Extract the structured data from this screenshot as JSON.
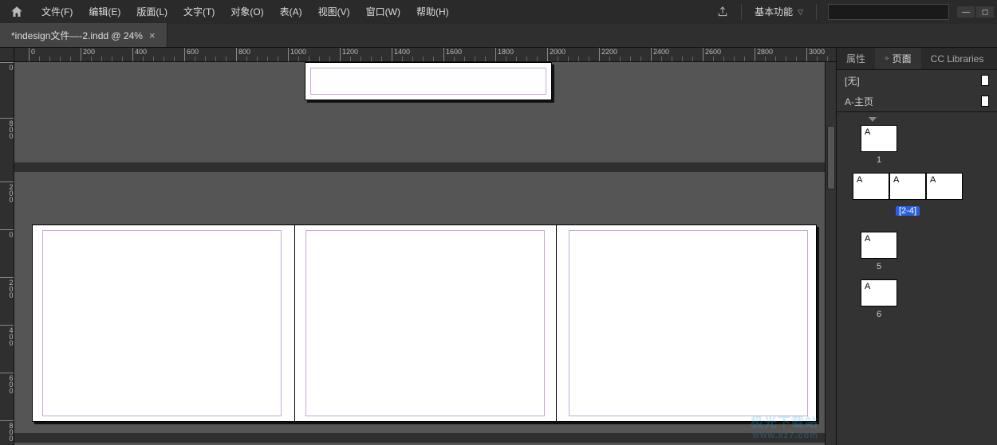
{
  "menubar": {
    "items": [
      "文件(F)",
      "编辑(E)",
      "版面(L)",
      "文字(T)",
      "对象(O)",
      "表(A)",
      "视图(V)",
      "窗口(W)",
      "帮助(H)"
    ],
    "workspace_label": "基本功能",
    "search_placeholder": ""
  },
  "document": {
    "tab_title": "*indesign文件—-2.indd @ 24%"
  },
  "rulers": {
    "h_ticks": [
      0,
      200,
      400,
      600,
      800,
      1000,
      1200,
      1400,
      1600,
      1800,
      2000,
      2200,
      2400,
      2600,
      2800,
      3000
    ],
    "v_ticks_upper": [
      0,
      800
    ],
    "v_ticks_lower": [
      200,
      0,
      200,
      400,
      600,
      800
    ]
  },
  "right_panel": {
    "tabs": {
      "properties": "属性",
      "pages": "页面",
      "cc": "CC Libraries"
    },
    "masters": {
      "none": "[无]",
      "a_master": "A-主页"
    },
    "pages": {
      "thumb_letter": "A",
      "labels": {
        "p1": "1",
        "spread": "[2-4]",
        "p5": "5",
        "p6": "6"
      }
    }
  },
  "watermark": {
    "line1": "极光下载站",
    "line2": "www.xz7.com"
  },
  "chart_data": null
}
